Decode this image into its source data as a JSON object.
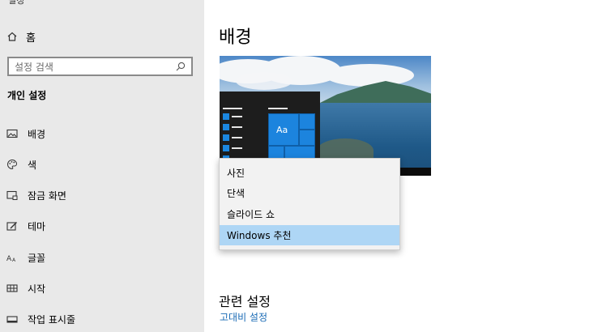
{
  "sidebar": {
    "cut_title": "설정",
    "home_label": "홈",
    "search_placeholder": "설정 검색",
    "section_heading": "개인 설정",
    "items": [
      {
        "label": "배경",
        "icon": "image-icon"
      },
      {
        "label": "색",
        "icon": "palette-icon"
      },
      {
        "label": "잠금 화면",
        "icon": "lock-screen-icon"
      },
      {
        "label": "테마",
        "icon": "theme-brush-icon"
      },
      {
        "label": "글꼴",
        "icon": "font-icon"
      },
      {
        "label": "시작",
        "icon": "start-grid-icon"
      },
      {
        "label": "작업 표시줄",
        "icon": "taskbar-icon"
      }
    ]
  },
  "main": {
    "title": "배경",
    "preview_tile_text": "Aa",
    "dropdown": {
      "options": [
        "사진",
        "단색",
        "슬라이드 쇼",
        "Windows 추천"
      ],
      "selected_index": 3
    },
    "related_heading": "관련 설정",
    "related_link": "고대비 설정"
  },
  "colors": {
    "sidebar_bg": "#e9e9e9",
    "accent": "#1a6bb5",
    "selected_option_bg": "#aed6f5"
  }
}
